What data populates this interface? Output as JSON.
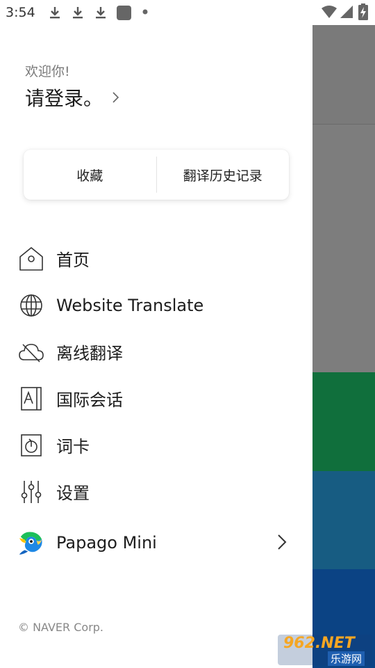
{
  "status_bar": {
    "time": "3:54",
    "icons": [
      "download-icon",
      "download-icon",
      "download-icon",
      "app-square-icon",
      "dot-icon",
      "wifi-icon",
      "signal-icon",
      "battery-charging-icon"
    ]
  },
  "drawer": {
    "welcome": "欢迎你!",
    "login_label": "请登录。",
    "quick": {
      "favorites": "收藏",
      "history": "翻译历史记录"
    },
    "menu": [
      {
        "label": "首页",
        "icon": "home-icon"
      },
      {
        "label": "Website Translate",
        "icon": "globe-icon"
      },
      {
        "label": "离线翻译",
        "icon": "cloud-offline-icon"
      },
      {
        "label": "国际会话",
        "icon": "conversation-icon"
      },
      {
        "label": "词卡",
        "icon": "word-card-icon"
      },
      {
        "label": "设置",
        "icon": "settings-sliders-icon"
      },
      {
        "label": "Papago Mini",
        "icon": "papago-parrot-icon"
      }
    ],
    "footer": "© NAVER Corp."
  },
  "watermark": {
    "top": "962.NET",
    "bottom": "乐游网"
  },
  "colors": {
    "strip_gray": "#7a7a7a",
    "strip_green": "#106f3c",
    "strip_teal": "#175c82",
    "strip_blue": "#0b4384"
  }
}
